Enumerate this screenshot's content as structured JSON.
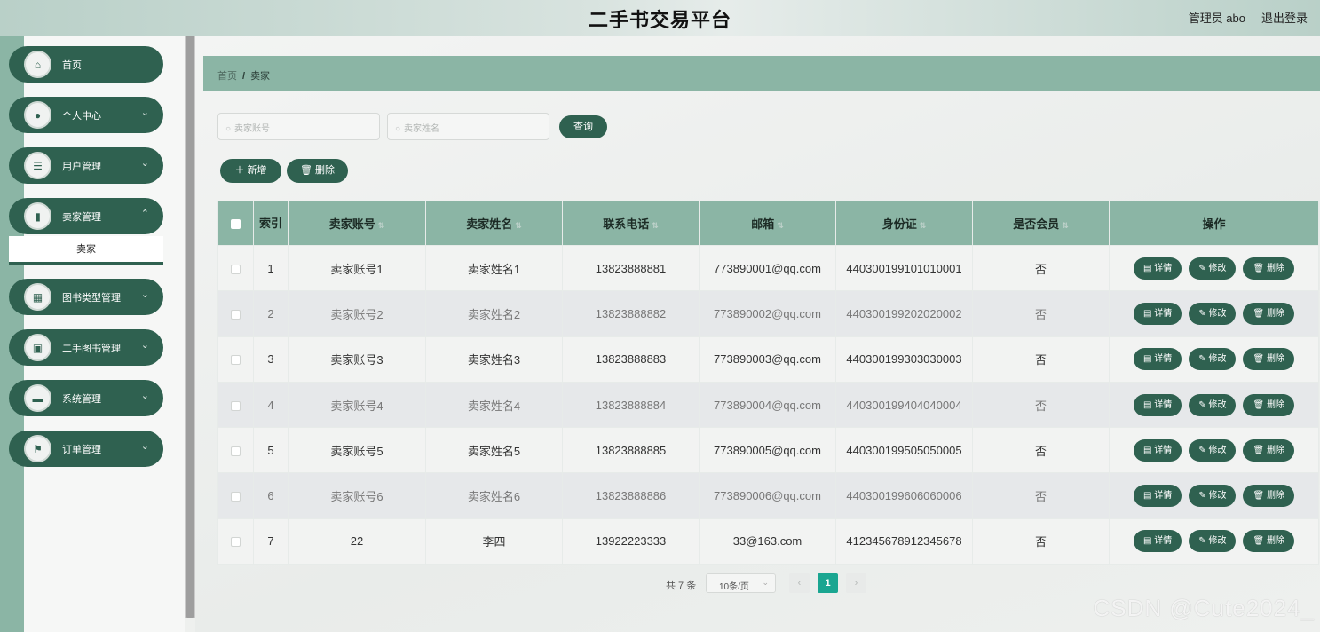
{
  "header": {
    "title": "二手书交易平台",
    "user": "管理员 abo",
    "logout": "退出登录"
  },
  "sidebar": {
    "items": [
      {
        "label": "首页",
        "icon": "home-icon"
      },
      {
        "label": "个人中心",
        "icon": "user-icon"
      },
      {
        "label": "用户管理",
        "icon": "list-icon"
      },
      {
        "label": "卖家管理",
        "icon": "chart-icon"
      },
      {
        "label": "图书类型管理",
        "icon": "grid-icon"
      },
      {
        "label": "二手图书管理",
        "icon": "clipboard-icon"
      },
      {
        "label": "系统管理",
        "icon": "chat-icon"
      },
      {
        "label": "订单管理",
        "icon": "flag-icon"
      }
    ],
    "submenu_active": "卖家"
  },
  "breadcrumb": {
    "home": "首页",
    "sep": "/",
    "current": "卖家"
  },
  "search": {
    "account_placeholder": "卖家账号",
    "name_placeholder": "卖家姓名",
    "query_label": "查询"
  },
  "toolbar": {
    "add_label": "新增",
    "delete_label": "删除"
  },
  "table": {
    "headers": {
      "index": "索引",
      "account": "卖家账号",
      "name": "卖家姓名",
      "phone": "联系电话",
      "email": "邮箱",
      "idcard": "身份证",
      "member": "是否会员",
      "actions": "操作"
    },
    "actions": {
      "detail": "详情",
      "edit": "修改",
      "delete": "删除"
    },
    "rows": [
      {
        "index": "1",
        "account": "卖家账号1",
        "name": "卖家姓名1",
        "phone": "13823888881",
        "email": "773890001@qq.com",
        "idcard": "440300199101010001",
        "member": "否"
      },
      {
        "index": "2",
        "account": "卖家账号2",
        "name": "卖家姓名2",
        "phone": "13823888882",
        "email": "773890002@qq.com",
        "idcard": "440300199202020002",
        "member": "否"
      },
      {
        "index": "3",
        "account": "卖家账号3",
        "name": "卖家姓名3",
        "phone": "13823888883",
        "email": "773890003@qq.com",
        "idcard": "440300199303030003",
        "member": "否"
      },
      {
        "index": "4",
        "account": "卖家账号4",
        "name": "卖家姓名4",
        "phone": "13823888884",
        "email": "773890004@qq.com",
        "idcard": "440300199404040004",
        "member": "否"
      },
      {
        "index": "5",
        "account": "卖家账号5",
        "name": "卖家姓名5",
        "phone": "13823888885",
        "email": "773890005@qq.com",
        "idcard": "440300199505050005",
        "member": "否"
      },
      {
        "index": "6",
        "account": "卖家账号6",
        "name": "卖家姓名6",
        "phone": "13823888886",
        "email": "773890006@qq.com",
        "idcard": "440300199606060006",
        "member": "否"
      },
      {
        "index": "7",
        "account": "22",
        "name": "李四",
        "phone": "13922223333",
        "email": "33@163.com",
        "idcard": "412345678912345678",
        "member": "否"
      }
    ]
  },
  "pagination": {
    "total": "共 7 条",
    "page_size": "10条/页",
    "current_page": "1"
  },
  "watermark": "CSDN @Cute2024_",
  "colors": {
    "primary": "#2f6150",
    "header_bg": "#8bb5a5",
    "page_active": "#1aa691"
  }
}
